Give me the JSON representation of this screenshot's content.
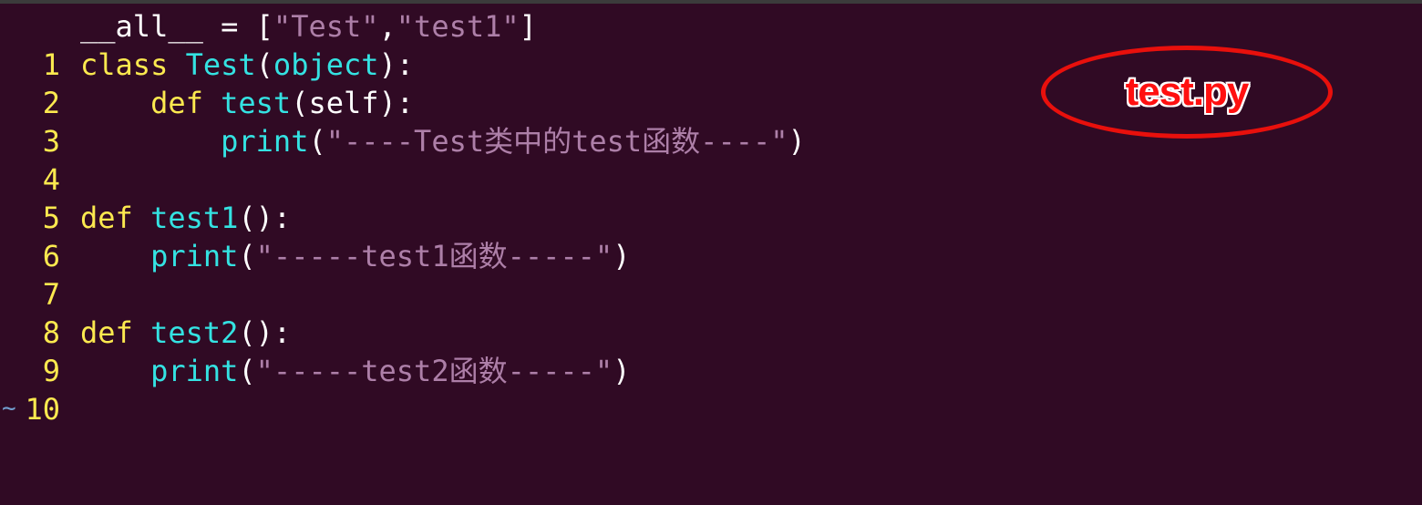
{
  "editor": {
    "filename_annotation": "test.py",
    "tilde": "~",
    "lines": [
      {
        "number": "1",
        "tokens": [
          {
            "t": "__all__ = [",
            "c": "plain"
          },
          {
            "t": "\"Test\"",
            "c": "str"
          },
          {
            "t": ",",
            "c": "plain"
          },
          {
            "t": "\"test1\"",
            "c": "str"
          },
          {
            "t": "]",
            "c": "plain"
          }
        ]
      },
      {
        "number": "2",
        "tokens": [
          {
            "t": "class ",
            "c": "kw"
          },
          {
            "t": "Test",
            "c": "fn"
          },
          {
            "t": "(",
            "c": "plain"
          },
          {
            "t": "object",
            "c": "fn"
          },
          {
            "t": "):",
            "c": "plain"
          }
        ]
      },
      {
        "number": "3",
        "tokens": [
          {
            "t": "    ",
            "c": "plain"
          },
          {
            "t": "def ",
            "c": "kw"
          },
          {
            "t": "test",
            "c": "fn"
          },
          {
            "t": "(self):",
            "c": "plain"
          }
        ]
      },
      {
        "number": "4",
        "tokens": [
          {
            "t": "        ",
            "c": "plain"
          },
          {
            "t": "print",
            "c": "fn"
          },
          {
            "t": "(",
            "c": "plain"
          },
          {
            "t": "\"----Test类中的test函数----\"",
            "c": "str"
          },
          {
            "t": ")",
            "c": "plain"
          }
        ]
      },
      {
        "number": "5",
        "tokens": []
      },
      {
        "number": "6",
        "tokens": [
          {
            "t": "def ",
            "c": "kw"
          },
          {
            "t": "test1",
            "c": "fn"
          },
          {
            "t": "():",
            "c": "plain"
          }
        ]
      },
      {
        "number": "7",
        "tokens": [
          {
            "t": "    ",
            "c": "plain"
          },
          {
            "t": "print",
            "c": "fn"
          },
          {
            "t": "(",
            "c": "plain"
          },
          {
            "t": "\"-----test1函数-----\"",
            "c": "str"
          },
          {
            "t": ")",
            "c": "plain"
          }
        ]
      },
      {
        "number": "8",
        "tokens": []
      },
      {
        "number": "9",
        "tokens": [
          {
            "t": "def ",
            "c": "kw"
          },
          {
            "t": "test2",
            "c": "fn"
          },
          {
            "t": "():",
            "c": "plain"
          }
        ]
      },
      {
        "number": "10",
        "tokens": [
          {
            "t": "    ",
            "c": "plain"
          },
          {
            "t": "print",
            "c": "fn"
          },
          {
            "t": "(",
            "c": "plain"
          },
          {
            "t": "\"-----test2函数-----\"",
            "c": "str"
          },
          {
            "t": ")",
            "c": "plain"
          }
        ]
      }
    ]
  },
  "colors": {
    "background": "#300a24",
    "line_number": "#fce94f",
    "keyword": "#fce94f",
    "function": "#34e2e2",
    "string": "#ad7fa8",
    "annotation": "#e8100c"
  }
}
